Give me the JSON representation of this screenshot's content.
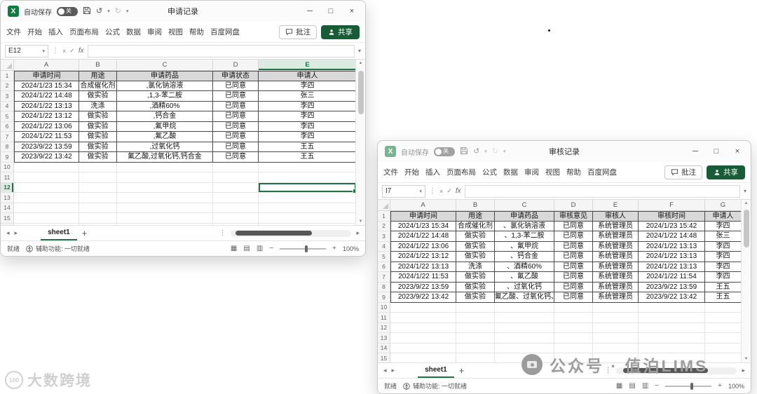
{
  "left_window": {
    "title": "申请记录",
    "autosave_label": "自动保存",
    "autosave_state": "关",
    "menu_tabs": [
      "文件",
      "开始",
      "插入",
      "页面布局",
      "公式",
      "数据",
      "审阅",
      "视图",
      "帮助",
      "百度网盘"
    ],
    "comment_button": "批注",
    "share_button": "共享",
    "name_box": "E12",
    "fx_label": "fx",
    "sheet": {
      "tab_name": "sheet1",
      "columns": [
        "A",
        "B",
        "C",
        "D",
        "E"
      ],
      "row_count": 16,
      "headers": [
        "申请时间",
        "用途",
        "申请药品",
        "申请状态",
        "申请人"
      ],
      "rows": [
        [
          "2024/1/23 15:34",
          "合成催化剂",
          ",氯化钠溶液",
          "已同意",
          "李四"
        ],
        [
          "2024/1/22 14:48",
          "做实验",
          ",1,3-苯二胺",
          "已同意",
          "张三"
        ],
        [
          "2024/1/22 13:13",
          "洗涤",
          ",酒精60%",
          "已同意",
          "李四"
        ],
        [
          "2024/1/22 13:12",
          "做实验",
          ",钙合金",
          "已同意",
          "李四"
        ],
        [
          "2024/1/22 13:06",
          "做实验",
          ",氟甲烷",
          "已同意",
          "李四"
        ],
        [
          "2024/1/22 11:53",
          "做实验",
          ",氟乙酸",
          "已同意",
          "李四"
        ],
        [
          "2023/9/22 13:59",
          "做实验",
          ",过氧化钙",
          "已同意",
          "王五"
        ],
        [
          "2023/9/22 13:42",
          "做实验",
          "氟乙酸,过氧化钙,钙合金",
          "已同意",
          "王五"
        ]
      ]
    },
    "statusbar": {
      "ready": "就绪",
      "accessibility": "辅助功能: 一切就绪",
      "zoom": "100%"
    }
  },
  "right_window": {
    "title": "审核记录",
    "autosave_label": "自动保存",
    "autosave_state": "关",
    "menu_tabs": [
      "文件",
      "开始",
      "插入",
      "页面布局",
      "公式",
      "数据",
      "审阅",
      "视图",
      "帮助",
      "百度网盘"
    ],
    "comment_button": "批注",
    "share_button": "共享",
    "name_box": "I7",
    "fx_label": "fx",
    "sheet": {
      "tab_name": "sheet1",
      "columns": [
        "A",
        "B",
        "C",
        "D",
        "E",
        "F",
        "G"
      ],
      "row_count": 15,
      "headers": [
        "申请时间",
        "用途",
        "申请药品",
        "审核意见",
        "审核人",
        "审核时间",
        "申请人"
      ],
      "rows": [
        [
          "2024/1/23 15:34",
          "合成催化剂",
          "、氯化钠溶液",
          "已同意",
          "系统管理员",
          "2024/1/23 15:42",
          "李四"
        ],
        [
          "2024/1/22 14:48",
          "做实验",
          "、1,3-苯二胺",
          "已同意",
          "系统管理员",
          "2024/1/22 14:48",
          "张三"
        ],
        [
          "2024/1/22 13:06",
          "做实验",
          "、氟甲烷",
          "已同意",
          "系统管理员",
          "2024/1/22 13:13",
          "李四"
        ],
        [
          "2024/1/22 13:12",
          "做实验",
          "、钙合金",
          "已同意",
          "系统管理员",
          "2024/1/22 13:13",
          "李四"
        ],
        [
          "2024/1/22 13:13",
          "洗涤",
          "、酒精60%",
          "已同意",
          "系统管理员",
          "2024/1/22 13:13",
          "李四"
        ],
        [
          "2024/1/22 11:53",
          "做实验",
          "、氟乙酸",
          "已同意",
          "系统管理员",
          "2024/1/22 11:54",
          "李四"
        ],
        [
          "2023/9/22 13:59",
          "做实验",
          "、过氧化钙",
          "已同意",
          "系统管理员",
          "2023/9/22 13:59",
          "王五"
        ],
        [
          "2023/9/22 13:42",
          "做实验",
          "氟乙酸、过氧化钙、钙合金",
          "已同意",
          "系统管理员",
          "2023/9/22 13:42",
          "王五"
        ]
      ]
    },
    "statusbar": {
      "ready": "就绪",
      "accessibility": "辅助功能: 一切就绪",
      "zoom": "100%"
    }
  },
  "watermarks": {
    "bottom_left": {
      "badge": "100",
      "text": "大数跨境"
    },
    "right": {
      "text": "公众号 · 值泊LIMS"
    }
  },
  "colors": {
    "excel_green": "#107C41",
    "selection_green": "#217346",
    "share_button_green": "#185c37",
    "table_header_fill": "#d9d9d9"
  }
}
